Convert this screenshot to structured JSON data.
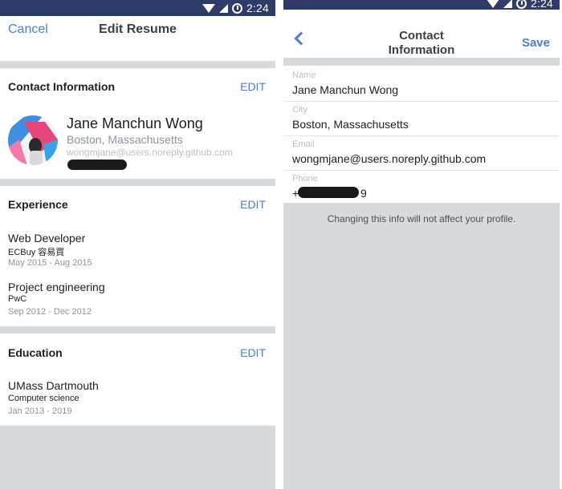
{
  "status_bar": {
    "time": "2:24"
  },
  "left_screen": {
    "cancel_label": "Cancel",
    "title": "Edit Resume",
    "contact": {
      "section_title": "Contact Information",
      "edit_label": "EDIT",
      "name": "Jane Manchun Wong",
      "city": "Boston, Massachusetts",
      "email": "wongmjane@users.noreply.github.com"
    },
    "experience": {
      "section_title": "Experience",
      "edit_label": "EDIT",
      "items": [
        {
          "title": "Web Developer",
          "company": "ECBuy 容易買",
          "dates": "May 2015 - Aug 2015"
        },
        {
          "title": "Project engineering",
          "company": "PwC",
          "dates": "Sep 2012 - Dec 2012"
        }
      ]
    },
    "education": {
      "section_title": "Education",
      "edit_label": "EDIT",
      "items": [
        {
          "school": "UMass Dartmouth",
          "field": "Computer science",
          "dates": "Jan 2013 - 2019"
        }
      ]
    }
  },
  "right_screen": {
    "title_line1": "Contact",
    "title_line2": "Information",
    "save_label": "Save",
    "fields": [
      {
        "label": "Name",
        "value": "Jane Manchun Wong"
      },
      {
        "label": "City",
        "value": "Boston, Massachusetts"
      },
      {
        "label": "Email",
        "value": "wongmjane@users.noreply.github.com"
      },
      {
        "label": "Phone",
        "prefix": "+",
        "suffix": "9"
      }
    ],
    "note": "Changing this info will not affect your profile."
  },
  "colors": {
    "accent": "#4a7fcf",
    "status_bar": "#2f3c69",
    "divider": "#d8d9dc"
  }
}
